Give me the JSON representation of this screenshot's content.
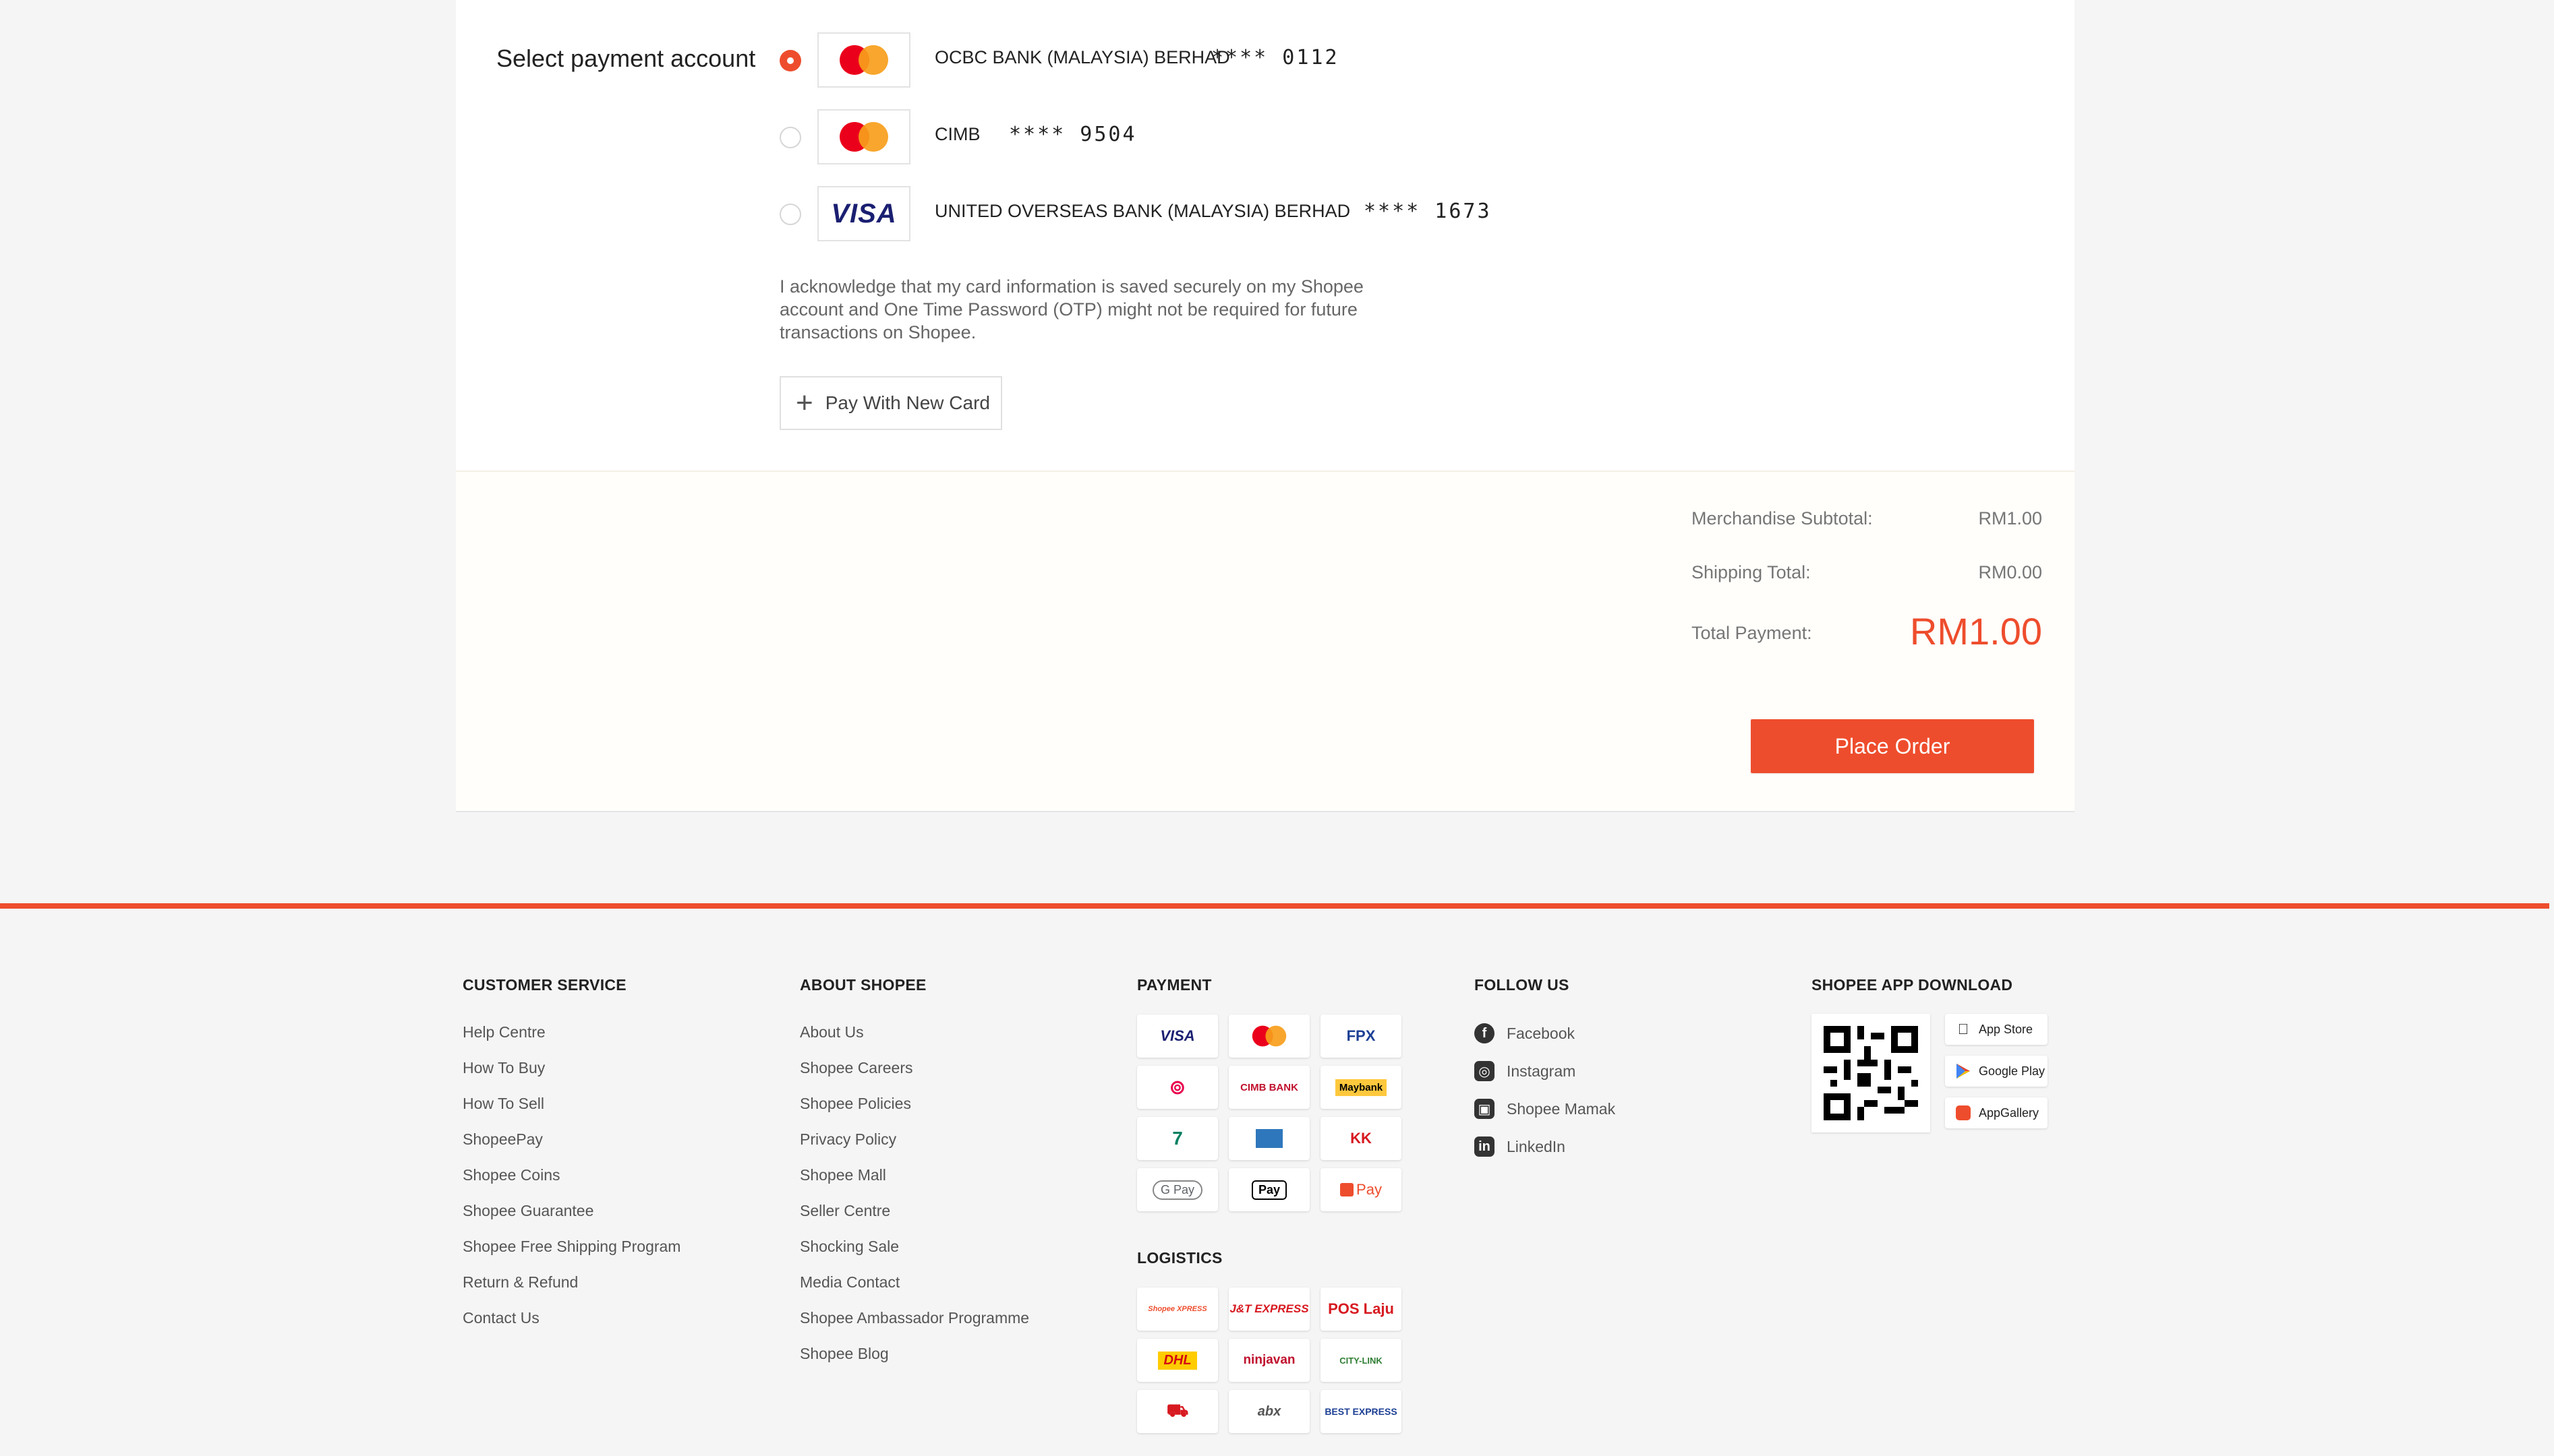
{
  "payment": {
    "label": "Select payment account",
    "accounts": [
      {
        "bank": "OCBC BANK (MALAYSIA) BERHAD",
        "masked": "**** 0112",
        "network": "mastercard",
        "selected": true
      },
      {
        "bank": "CIMB",
        "masked": "**** 9504",
        "network": "mastercard",
        "selected": false
      },
      {
        "bank": "UNITED OVERSEAS BANK (MALAYSIA) BERHAD",
        "masked": "**** 1673",
        "network": "visa",
        "selected": false
      }
    ],
    "visa_text": "VISA",
    "acknowledgement": "I acknowledge that my card information is saved securely on my Shopee account and One Time Password (OTP) might not be required for future transactions on Shopee.",
    "new_card_label": "Pay With New Card"
  },
  "summary": {
    "subtotal_label": "Merchandise Subtotal:",
    "subtotal_value": "RM1.00",
    "shipping_label": "Shipping Total:",
    "shipping_value": "RM0.00",
    "total_label": "Total Payment:",
    "total_value": "RM1.00"
  },
  "place_order_label": "Place Order",
  "footer": {
    "customer_service": {
      "title": "CUSTOMER SERVICE",
      "links": [
        "Help Centre",
        "How To Buy",
        "How To Sell",
        "ShopeePay",
        "Shopee Coins",
        "Shopee Guarantee",
        "Shopee Free Shipping Program",
        "Return & Refund",
        "Contact Us"
      ]
    },
    "about": {
      "title": "ABOUT SHOPEE",
      "links": [
        "About Us",
        "Shopee Careers",
        "Shopee Policies",
        "Privacy Policy",
        "Shopee Mall",
        "Seller Centre",
        "Shocking Sale",
        "Media Contact",
        "Shopee Ambassador Programme",
        "Shopee Blog"
      ]
    },
    "payment_title": "PAYMENT",
    "payment_logos": [
      "VISA",
      "",
      "FPX",
      "",
      "CIMB BANK",
      "Maybank",
      "",
      "",
      "KK",
      "G Pay",
      "Pay",
      "Pay"
    ],
    "logistics_title": "LOGISTICS",
    "logistics_logos": [
      "Shopee XPRESS",
      "J&T EXPRESS",
      "POS Laju",
      "DHL",
      "ninjavan",
      "CITY-LINK",
      "",
      "abx",
      "BEST EXPRESS"
    ],
    "follow_title": "FOLLOW US",
    "follow_links": [
      "Facebook",
      "Instagram",
      "Shopee Mamak",
      "LinkedIn"
    ],
    "app_title": "SHOPEE APP DOWNLOAD",
    "stores": [
      "App Store",
      "Google Play",
      "AppGallery"
    ]
  },
  "colors": {
    "brand": "#ee4d2d",
    "visa": "#1a1f71",
    "mc_red": "#eb001b",
    "mc_orange": "#f79e1b"
  }
}
